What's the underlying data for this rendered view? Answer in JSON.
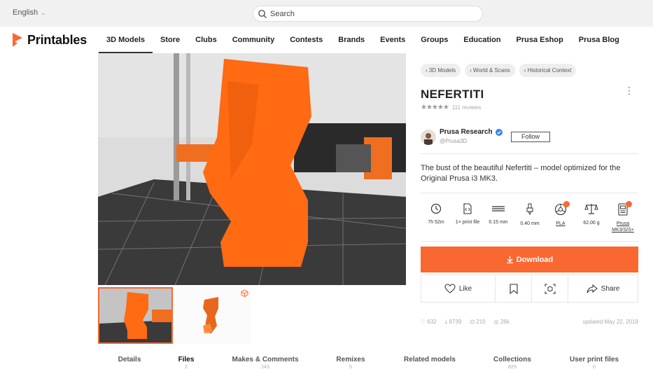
{
  "topbar": {
    "language": "English",
    "search_placeholder": "Search"
  },
  "brand": {
    "name": "Printables",
    "accent": "#fa6831"
  },
  "nav": {
    "items": [
      {
        "label": "3D Models"
      },
      {
        "label": "Store"
      },
      {
        "label": "Clubs"
      },
      {
        "label": "Community"
      },
      {
        "label": "Contests"
      },
      {
        "label": "Brands"
      },
      {
        "label": "Events"
      },
      {
        "label": "Groups"
      },
      {
        "label": "Education"
      },
      {
        "label": "Prusa Eshop"
      },
      {
        "label": "Prusa Blog"
      }
    ],
    "active": "3D Models"
  },
  "model": {
    "breadcrumbs": [
      {
        "label": "3D Models"
      },
      {
        "label": "World & Scans"
      },
      {
        "label": "Historical Context"
      }
    ],
    "title": "NEFERTITI",
    "rating": 4.5,
    "reviews": "111 reviews",
    "author": {
      "name": "Prusa Research",
      "handle": "@Prusa3D",
      "follow_label": "Follow"
    },
    "description": "The bust of the beautiful Nefertiti – model optimized for the Original Prusa i3 MK3.",
    "specs": [
      {
        "icon": "clock-icon",
        "label": "7h 52m"
      },
      {
        "icon": "file-icon",
        "label": "1× print file"
      },
      {
        "icon": "layer-height-icon",
        "label": "0.15 mm"
      },
      {
        "icon": "nozzle-icon",
        "label": "0.40 mm"
      },
      {
        "icon": "material-spool-icon",
        "label": "PLA"
      },
      {
        "icon": "scale-icon",
        "label": "62.00 g"
      },
      {
        "icon": "printer-icon",
        "label": "Prusa MK3/S/S+"
      }
    ],
    "download_label": "Download",
    "actions": {
      "like": "Like",
      "share": "Share"
    },
    "stats": {
      "likes": "632",
      "downloads": "8739",
      "prints": "210",
      "views": "26k",
      "updated": "updated May 22, 2019"
    }
  },
  "tabs": [
    {
      "label": "Details",
      "count": ""
    },
    {
      "label": "Files",
      "count": "2"
    },
    {
      "label": "Makes & Comments",
      "count": "243"
    },
    {
      "label": "Remixes",
      "count": "5"
    },
    {
      "label": "Related models",
      "count": ""
    },
    {
      "label": "Collections",
      "count": "829"
    },
    {
      "label": "User print files",
      "count": "0"
    }
  ],
  "active_tab": "Files"
}
